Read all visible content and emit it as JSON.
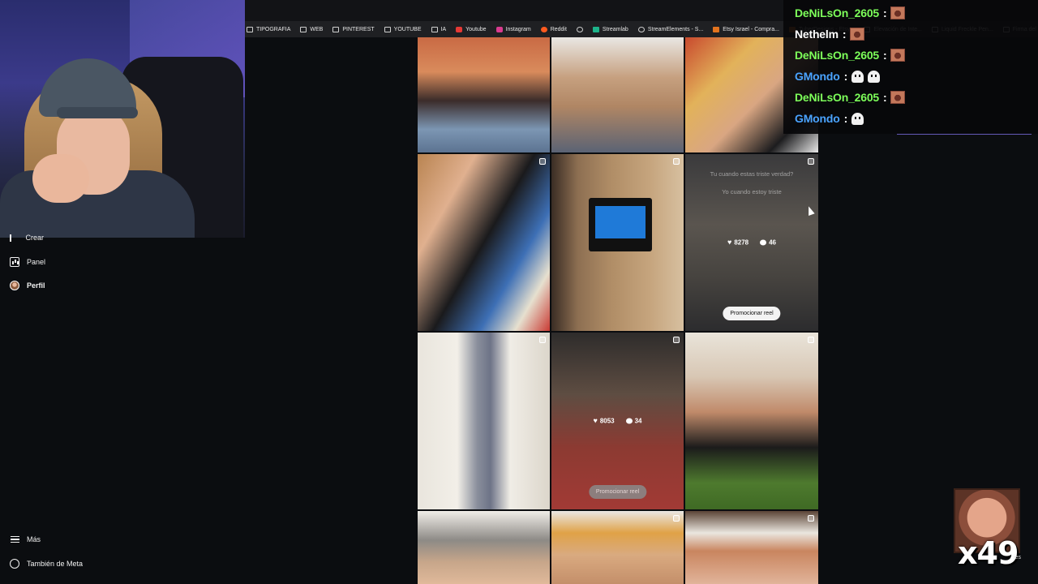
{
  "bookmarks": [
    {
      "label": "TIPOGRAFIA",
      "icon": "folder-icon"
    },
    {
      "label": "WEB",
      "icon": "folder-icon"
    },
    {
      "label": "PINTEREST",
      "icon": "folder-icon"
    },
    {
      "label": "YOUTUBE",
      "icon": "folder-icon"
    },
    {
      "label": "IA",
      "icon": "folder-icon"
    },
    {
      "label": "Youtube",
      "icon": "youtube-icon"
    },
    {
      "label": "Instagram",
      "icon": "instagram-icon"
    },
    {
      "label": "Reddit",
      "icon": "reddit-icon"
    },
    {
      "label": "",
      "icon": "globe-icon"
    },
    {
      "label": "Streamlab",
      "icon": "streamlabs-icon"
    },
    {
      "label": "StreamElements - S...",
      "icon": "streamelements-icon"
    },
    {
      "label": "Etsy Israel - Compra...",
      "icon": "etsy-icon"
    },
    {
      "label": "TuberDesigns - Etsy...",
      "icon": "etsy-icon"
    },
    {
      "label": "Elevación de Inte...",
      "icon": "page-icon"
    },
    {
      "label": "Liquid Freckle Pen...",
      "icon": "page-icon"
    },
    {
      "label": "Firma del Certificad...",
      "icon": "page-icon"
    }
  ],
  "sidebar": {
    "crear_label": "Crear",
    "panel_label": "Panel",
    "perfil_label": "Perfil",
    "mas_label": "Más",
    "meta_label": "También de Meta"
  },
  "grid": {
    "tile_captions": [
      "Tu cuando estas triste verdad?",
      "Yo cuando estoy triste"
    ],
    "tile6_likes": "8278",
    "tile6_comments": "46",
    "tile6_promo": "Promocionar reel",
    "tile8_likes": "8053",
    "tile8_comments": "34",
    "tile8_promo": "Promocionar reel"
  },
  "chat": {
    "messages": [
      {
        "user": "DeNiLsOn_2605",
        "color": "#7dff5a",
        "emotes": [
          "wk"
        ]
      },
      {
        "user": "Nethelm",
        "color": "#ffffff",
        "emotes": [
          "wk"
        ]
      },
      {
        "user": "DeNiLsOn_2605",
        "color": "#7dff5a",
        "emotes": [
          "wk"
        ]
      },
      {
        "user": "GMondo",
        "color": "#4aa3ff",
        "emotes": [
          "ghost",
          "ghost"
        ]
      },
      {
        "user": "DeNiLsOn_2605",
        "color": "#7dff5a",
        "emotes": [
          "wk"
        ]
      },
      {
        "user": "GMondo",
        "color": "#4aa3ff",
        "emotes": [
          "ghost"
        ]
      }
    ],
    "colon": ":"
  },
  "emote_counter": "x49",
  "messages_fragment": "jes",
  "colors": {
    "background": "#0b0d10",
    "username_green": "#7dff5a",
    "username_blue": "#4aa3ff"
  }
}
